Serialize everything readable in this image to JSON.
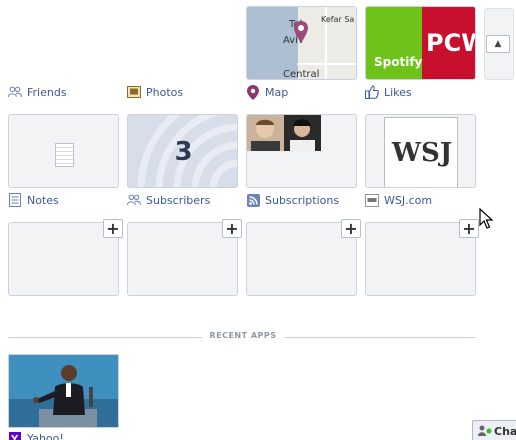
{
  "grid": {
    "labels": {
      "friends": "Friends",
      "photos": "Photos",
      "map": "Map",
      "likes": "Likes",
      "notes": "Notes",
      "subscribers": "Subscribers",
      "subscriptions": "Subscriptions",
      "wsj": "WSJ.com"
    },
    "map_labels": {
      "city": "Tel Aviv",
      "city_part1": "Tel",
      "city_part2": "Aviv",
      "town": "Kefar Sa",
      "region": "Central"
    },
    "likes_tiles": {
      "spotify": "Spotify",
      "pcw": "PCW"
    },
    "subscribers_count": "3",
    "wsj_logo": "WSJ",
    "add_button": "+",
    "scroll_up": "▲"
  },
  "recent_apps": {
    "title": "RECENT APPS",
    "items": [
      {
        "label": "Yahoo!"
      }
    ]
  },
  "chat": {
    "label": "Cha"
  },
  "colors": {
    "link": "#3b5998",
    "tile_bg": "#f2f3f5",
    "border": "#ccd2dd"
  }
}
